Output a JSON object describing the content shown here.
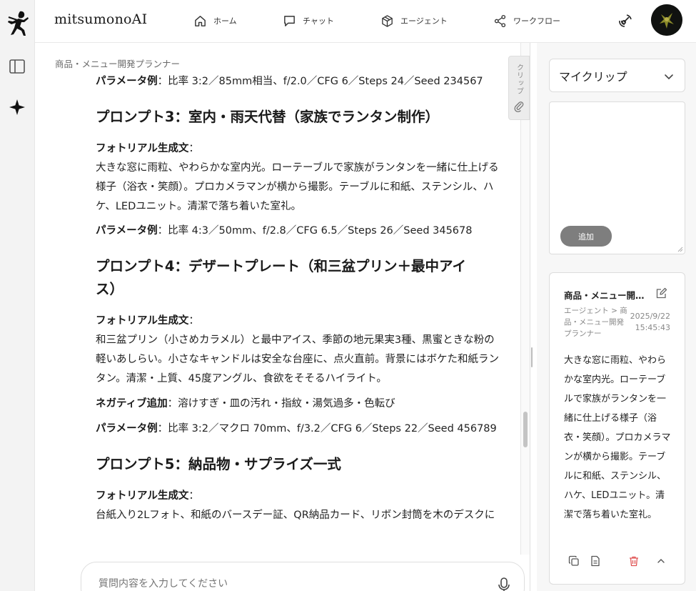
{
  "app": {
    "brand": "mitsumonoAI"
  },
  "nav": [
    {
      "label": "ホーム",
      "icon": "home-icon"
    },
    {
      "label": "チャット",
      "icon": "chat-icon"
    },
    {
      "label": "エージェント",
      "icon": "cube-icon"
    },
    {
      "label": "ワークフロー",
      "icon": "share-icon"
    }
  ],
  "main": {
    "agent_title": "商品・メニュー開発プランナー",
    "clip_tab_label": "クリップ",
    "input_placeholder": "質問内容を入力してください",
    "blocks": {
      "p2_params_label": "パラメータ例",
      "p2_params": "：比率 3:2／85mm相当、f/2.0／CFG 6／Steps 24／Seed 234567",
      "p3_heading": "プロンプト3：室内・雨天代替（家族でランタン制作）",
      "p3_photo_label": "フォトリアル生成文",
      "p3_photo_colon": "：",
      "p3_text1": "大きな窓に雨粒、やわらかな室内光。ローテーブルで家族がランタンを一緒に仕上げる",
      "p3_text2": "様子（浴衣・笑顔）。プロカメラマンが横から撮影。テーブルに和紙、ステンシル、ハ",
      "p3_text3": "ケ、LEDユニット。清潔で落ち着いた室礼。",
      "p3_params_label": "パラメータ例",
      "p3_params": "：比率 4:3／50mm、f/2.8／CFG 6.5／Steps 26／Seed 345678",
      "p4_heading1": "プロンプト4：デザートプレート（和三盆プリン＋最中アイ",
      "p4_heading2": "ス）",
      "p4_photo_label": "フォトリアル生成文",
      "p4_photo_colon": "：",
      "p4_text1": "和三盆プリン（小さめカラメル）と最中アイス、季節の地元果実3種、黒蜜ときな粉の",
      "p4_text2": "軽いあしらい。小さなキャンドルは安全な台座に、点火直前。背景にはボケた和紙ラン",
      "p4_text3": "タン。清潔・上質、45度アングル、食欲をそそるハイライト。",
      "p4_neg_label": "ネガティブ追加",
      "p4_neg": "：溶けすぎ・皿の汚れ・指紋・湯気過多・色転び",
      "p4_params_label": "パラメータ例",
      "p4_params": "：比率 3:2／マクロ 70mm、f/3.2／CFG 6／Steps 22／Seed 456789",
      "p5_heading": "プロンプト5：納品物・サプライズ一式",
      "p5_photo_label": "フォトリアル生成文",
      "p5_photo_colon": "：",
      "p5_text1": "台紙入り2Lフォト、和紙のバースデー証、QR納品カード、リボン封筒を木のデスクに"
    }
  },
  "right_panel": {
    "select_label": "マイクリップ",
    "add_button": "追加",
    "card": {
      "title": "商品・メニュー開発プランナー",
      "path": "エージェント > 商品・メニュー開発プランナー",
      "date": "2025/9/22",
      "time": "15:45:43",
      "body": "大きな窓に雨粒、やわらかな室内光。ローテーブルで家族がランタンを一緒に仕上げる様子（浴衣・笑顔）。プロカメラマンが横から撮影。テーブルに和紙、ステンシル、ハケ、LEDユニット。清潔で落ち着いた室礼。"
    }
  },
  "colors": {
    "accent_danger": "#e05353",
    "rail_bg": "#f3f3f3",
    "add_button_bg": "#7e7e7e"
  }
}
